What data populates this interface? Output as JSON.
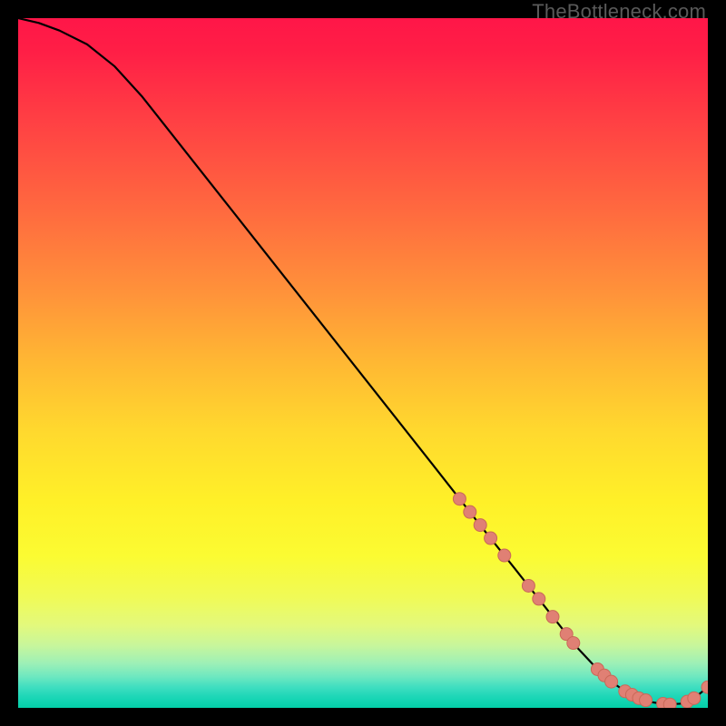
{
  "watermark": "TheBottleneck.com",
  "colors": {
    "curve_stroke": "#000000",
    "marker_fill": "#e08074",
    "marker_stroke": "#c96858",
    "background": "#000000"
  },
  "chart_data": {
    "type": "line",
    "title": "",
    "xlabel": "",
    "ylabel": "",
    "xlim": [
      0,
      100
    ],
    "ylim": [
      0,
      100
    ],
    "grid": false,
    "x": [
      0,
      3,
      6,
      10,
      14,
      18,
      24,
      30,
      36,
      42,
      48,
      54,
      60,
      64,
      68,
      72,
      75,
      78,
      81,
      84,
      86,
      88,
      90,
      92,
      94,
      96,
      98,
      100
    ],
    "values": [
      100,
      99.3,
      98.2,
      96.2,
      93.0,
      88.6,
      81.0,
      73.4,
      65.8,
      58.2,
      50.6,
      43.0,
      35.4,
      30.3,
      25.2,
      20.2,
      16.4,
      12.6,
      8.8,
      5.6,
      3.8,
      2.4,
      1.4,
      0.8,
      0.5,
      0.6,
      1.4,
      3.0
    ],
    "markers_x": [
      64,
      65.5,
      67,
      68.5,
      70.5,
      74,
      75.5,
      77.5,
      79.5,
      80.5,
      84,
      85,
      86,
      88,
      89,
      90,
      91,
      93.5,
      94.5,
      97,
      98,
      100
    ],
    "markers_y": [
      30.3,
      28.4,
      26.5,
      24.6,
      22.1,
      17.7,
      15.8,
      13.2,
      10.7,
      9.4,
      5.6,
      4.7,
      3.8,
      2.4,
      1.9,
      1.4,
      1.1,
      0.6,
      0.5,
      0.9,
      1.4,
      3.0
    ]
  }
}
